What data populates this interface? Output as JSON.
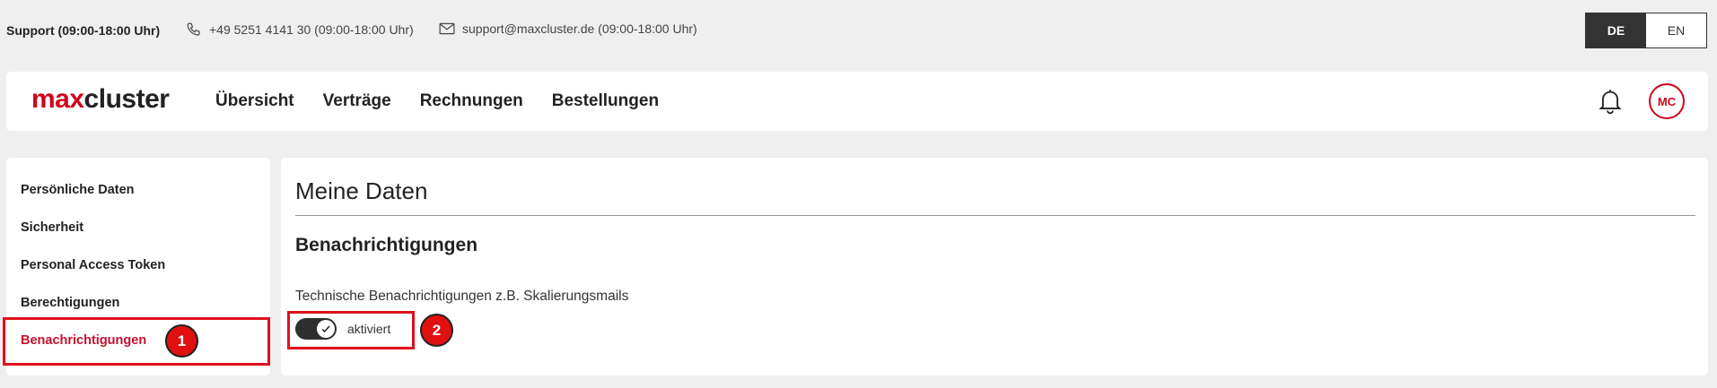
{
  "topbar": {
    "support_title": "Support (09:00-18:00 Uhr)",
    "phone": "+49 5251 4141 30 (09:00-18:00 Uhr)",
    "email": "support@maxcluster.de (09:00-18:00 Uhr)",
    "phone_icon": "phone-icon",
    "mail_icon": "mail-icon",
    "languages": [
      {
        "label": "DE",
        "active": true
      },
      {
        "label": "EN",
        "active": false
      }
    ]
  },
  "header": {
    "logo_max": "max",
    "logo_cluster": "cluster",
    "nav": [
      "Übersicht",
      "Verträge",
      "Rechnungen",
      "Bestellungen"
    ],
    "bell_icon": "bell-icon",
    "avatar_initials": "MC",
    "brand_color": "#d0021b"
  },
  "sidebar": {
    "items": [
      {
        "label": "Persönliche Daten",
        "active": false
      },
      {
        "label": "Sicherheit",
        "active": false
      },
      {
        "label": "Personal Access Token",
        "active": false
      },
      {
        "label": "Berechtigungen",
        "active": false
      },
      {
        "label": "Benachrichtigungen",
        "active": true
      }
    ]
  },
  "main": {
    "title": "Meine Daten",
    "section_title": "Benachrichtigungen",
    "field_label": "Technische Benachrichtigungen z.B. Skalierungsmails",
    "toggle_label": "aktiviert",
    "toggle_on": true
  },
  "annotations": {
    "marker1": "1",
    "marker2": "2",
    "highlight_color": "#e0101e"
  }
}
